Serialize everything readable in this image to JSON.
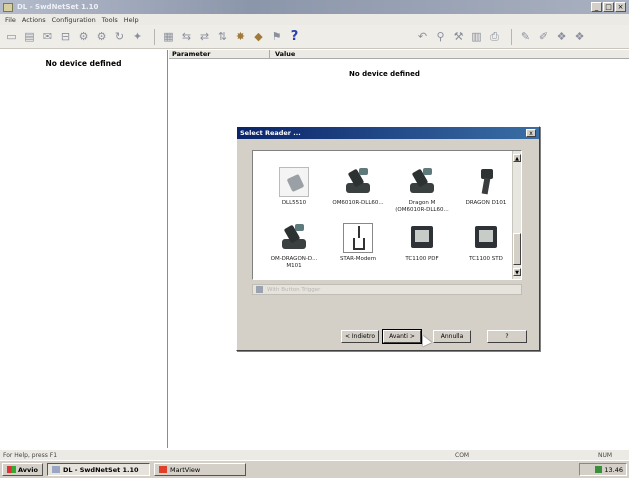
{
  "window": {
    "title": "DL - SwdNetSet 1.10"
  },
  "menu": [
    "File",
    "Actions",
    "Configuration",
    "Tools",
    "Help"
  ],
  "toolbar": {
    "icons": [
      "new-icon",
      "save-icon",
      "close-icon",
      "open-icon",
      "device-icon",
      "device2-icon",
      "refresh-icon",
      "config-icon",
      "list-icon",
      "send-icon",
      "receive-icon",
      "transfer-icon",
      "star-icon",
      "gem-icon",
      "flag-icon",
      "help-icon",
      "undo-icon",
      "find-icon",
      "tools-icon",
      "grid-icon",
      "print-icon",
      "edit-icon",
      "edit2-icon",
      "paint-icon",
      "paint2-icon"
    ],
    "help_label": "?"
  },
  "left_pane": {
    "message": "No device defined"
  },
  "right_pane": {
    "col_parameter": "Parameter",
    "col_value": "Value",
    "message": "No device defined"
  },
  "dialog": {
    "title": "Select Reader ...",
    "close": "x",
    "devices": [
      {
        "name": "DLL5510",
        "icon": "hand-scanner"
      },
      {
        "name": "OM6010R-DLL60...",
        "icon": "desk-scanner"
      },
      {
        "name": "Dragon M (OM6010R-DLL60...",
        "icon": "desk-scanner"
      },
      {
        "name": "DRAGON D101",
        "icon": "gun-scanner"
      },
      {
        "name": "OM-DRAGON-D... M101",
        "icon": "desk-scanner"
      },
      {
        "name": "STAR-Modem",
        "icon": "modem"
      },
      {
        "name": "TC1100 PDF",
        "icon": "terminal"
      },
      {
        "name": "TC1100 STD",
        "icon": "terminal"
      }
    ],
    "auto_option": "With Button Trigger",
    "buttons": {
      "back": "< Indietro",
      "next": "Avanti >",
      "cancel": "Annulla",
      "help": "?"
    }
  },
  "status": {
    "help": "For Help, press F1",
    "com": "COM",
    "num": "NUM"
  },
  "taskbar": {
    "start": "Avvio",
    "items": [
      "DL - SwdNetSet 1.10",
      "MartView"
    ],
    "clock": "13.46"
  }
}
